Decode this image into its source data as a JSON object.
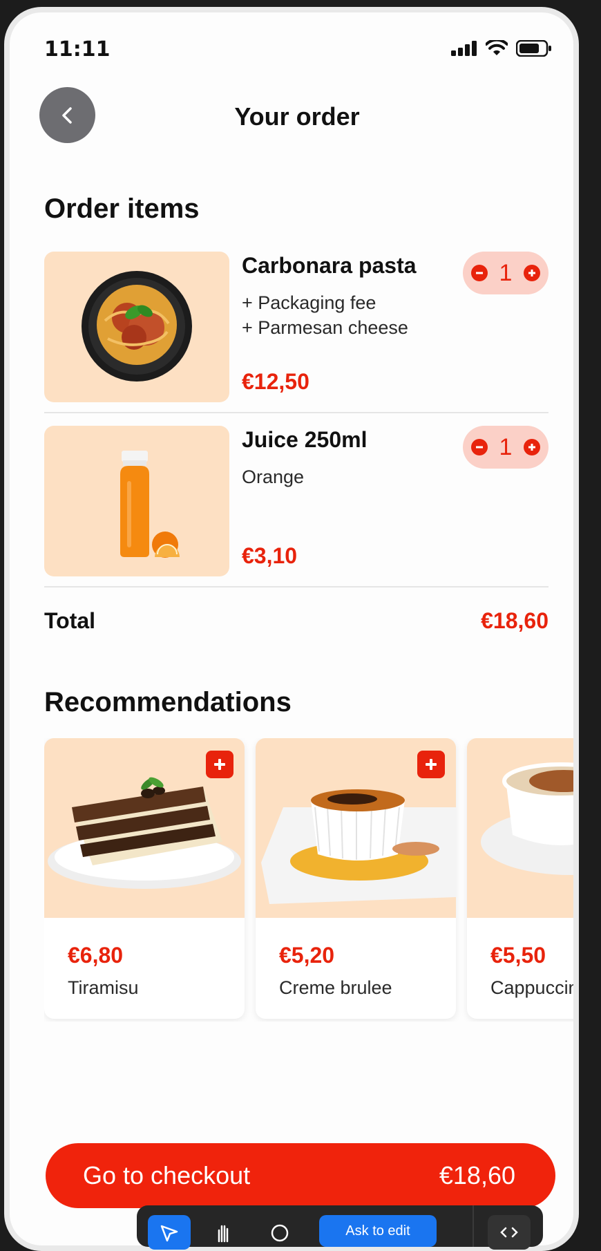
{
  "status_bar": {
    "time": "11:11"
  },
  "header": {
    "title": "Your order"
  },
  "order_section": {
    "title": "Order items"
  },
  "order_items": [
    {
      "name": "Carbonara pasta",
      "options": [
        "+ Packaging fee",
        "+ Parmesan cheese"
      ],
      "price": "€12,50",
      "quantity": "1",
      "image": "pasta-plate"
    },
    {
      "name": "Juice 250ml",
      "options": [
        "Orange"
      ],
      "price": "€3,10",
      "quantity": "1",
      "image": "juice-bottle"
    }
  ],
  "total": {
    "label": "Total",
    "value": "€18,60"
  },
  "recommendations": {
    "title": "Recommendations",
    "items": [
      {
        "price": "€6,80",
        "name": "Tiramisu",
        "image": "tiramisu"
      },
      {
        "price": "€5,20",
        "name": "Creme brulee",
        "image": "creme-brulee"
      },
      {
        "price": "€5,50",
        "name": "Cappuccino",
        "image": "cappuccino"
      }
    ]
  },
  "checkout": {
    "label": "Go to checkout",
    "amount": "€18,60"
  },
  "toolbar": {
    "ask_label": "Ask to edit"
  },
  "colors": {
    "accent": "#e8230c",
    "image_bg": "#fde0c3",
    "stepper_bg": "#fbd0c7"
  }
}
